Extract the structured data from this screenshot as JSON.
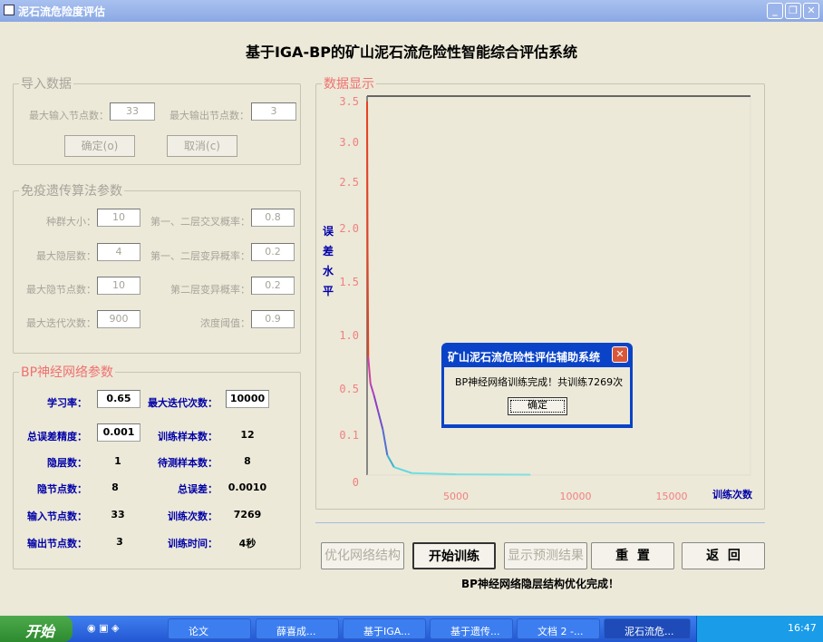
{
  "window": {
    "title": "泥石流危险度评估",
    "min": "_",
    "restore": "❐",
    "close": "✕"
  },
  "app_title": "基于IGA-BP的矿山泥石流危险性智能综合评估系统",
  "import": {
    "legend": "导入数据",
    "max_in_label": "最大输入节点数：",
    "max_in": "33",
    "max_out_label": "最大输出节点数：",
    "max_out": "3",
    "ok": "确定(o)",
    "cancel": "取消(c)"
  },
  "iga": {
    "legend": "免疫遗传算法参数",
    "pop_label": "种群大小：",
    "pop": "10",
    "cross_label": "第一、二层交叉概率：",
    "cross": "0.8",
    "layers_label": "最大隐层数：",
    "layers": "4",
    "mut12_label": "第一、二层变异概率：",
    "mut12": "0.2",
    "nodes_label": "最大隐节点数：",
    "nodes": "10",
    "mut2_label": "第二层变异概率：",
    "mut2": "0.2",
    "iter_label": "最大迭代次数：",
    "iter": "900",
    "conc_label": "浓度阈值：",
    "conc": "0.9"
  },
  "bp": {
    "legend": "BP神经网络参数",
    "lr_label": "学习率：",
    "lr": "0.65",
    "maxit_label": "最大迭代次数：",
    "maxit": "10000",
    "prec_label": "总误差精度：",
    "prec": "0.001",
    "train_n_label": "训练样本数：",
    "train_n": "12",
    "hl_label": "隐层数：",
    "hl": "1",
    "test_n_label": "待测样本数：",
    "test_n": "8",
    "hn_label": "隐节点数：",
    "hn": "8",
    "err_label": "总误差：",
    "err": "0.0010",
    "in_label": "输入节点数：",
    "in": "33",
    "count_label": "训练次数：",
    "count": "7269",
    "out_label": "输出节点数：",
    "out": "3",
    "time_label": "训练时间：",
    "time": "4秒"
  },
  "display": {
    "legend": "数据显示"
  },
  "chart_data": {
    "type": "line",
    "title": "",
    "xlabel": "训练次数",
    "ylabel": "误差水平",
    "yticks": [
      "3.5",
      "3.0",
      "2.5",
      "2.0",
      "1.5",
      "1.0",
      "0.5",
      "0.1",
      "0"
    ],
    "xticks": [
      "5000",
      "10000",
      "15000"
    ],
    "ylim": [
      0,
      3.5
    ],
    "xlim": [
      0,
      17000
    ],
    "x": [
      0,
      20,
      50,
      150,
      300,
      500,
      700,
      900,
      1200,
      2000,
      4000,
      7269
    ],
    "y": [
      3.5,
      1.8,
      0.8,
      0.55,
      0.45,
      0.3,
      0.15,
      0.05,
      0.02,
      0.005,
      0.002,
      0.001
    ]
  },
  "buttons": {
    "optimize": "优化网络结构",
    "train": "开始训练",
    "show": "显示预测结果",
    "reset": "重  置",
    "back": "返  回"
  },
  "status": "BP神经网络隐层结构优化完成！",
  "dialog": {
    "title": "矿山泥石流危险性评估辅助系统",
    "message": "BP神经网络训练完成！共训练7269次",
    "ok": "确定"
  },
  "taskbar": {
    "start": "开始",
    "items": [
      "论文",
      "薛喜成...",
      "基于IGA...",
      "基于遗传...",
      "文档 2 -...",
      "泥石流危..."
    ],
    "clock": "16:47"
  }
}
